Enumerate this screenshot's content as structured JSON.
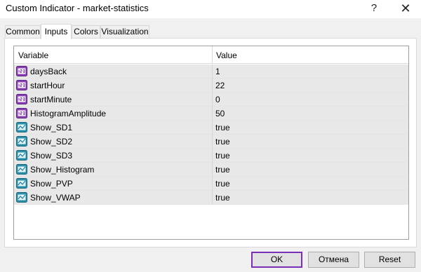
{
  "window": {
    "title": "Custom Indicator - market-statistics",
    "help_label": "?",
    "close_label": "✕"
  },
  "tabs": [
    {
      "label": "Common"
    },
    {
      "label": "Inputs"
    },
    {
      "label": "Colors"
    },
    {
      "label": "Visualization"
    }
  ],
  "active_tab": "Inputs",
  "table": {
    "columns": [
      "Variable",
      "Value"
    ],
    "rows": [
      {
        "icon": "integer-icon",
        "variable": "daysBack",
        "value": "1"
      },
      {
        "icon": "integer-icon",
        "variable": "startHour",
        "value": "22"
      },
      {
        "icon": "integer-icon",
        "variable": "startMinute",
        "value": "0"
      },
      {
        "icon": "integer-icon",
        "variable": "HistogramAmplitude",
        "value": "50"
      },
      {
        "icon": "boolean-icon",
        "variable": "Show_SD1",
        "value": "true"
      },
      {
        "icon": "boolean-icon",
        "variable": "Show_SD2",
        "value": "true"
      },
      {
        "icon": "boolean-icon",
        "variable": "Show_SD3",
        "value": "true"
      },
      {
        "icon": "boolean-icon",
        "variable": "Show_Histogram",
        "value": "true"
      },
      {
        "icon": "boolean-icon",
        "variable": "Show_PVP",
        "value": "true"
      },
      {
        "icon": "boolean-icon",
        "variable": "Show_VWAP",
        "value": "true"
      }
    ]
  },
  "buttons": {
    "ok": "OK",
    "cancel": "Отмена",
    "reset": "Reset"
  },
  "colors": {
    "default_button_border": "#7b2fb8",
    "integer_icon": "#8a3fb5",
    "boolean_icon": "#2a8fa8"
  }
}
